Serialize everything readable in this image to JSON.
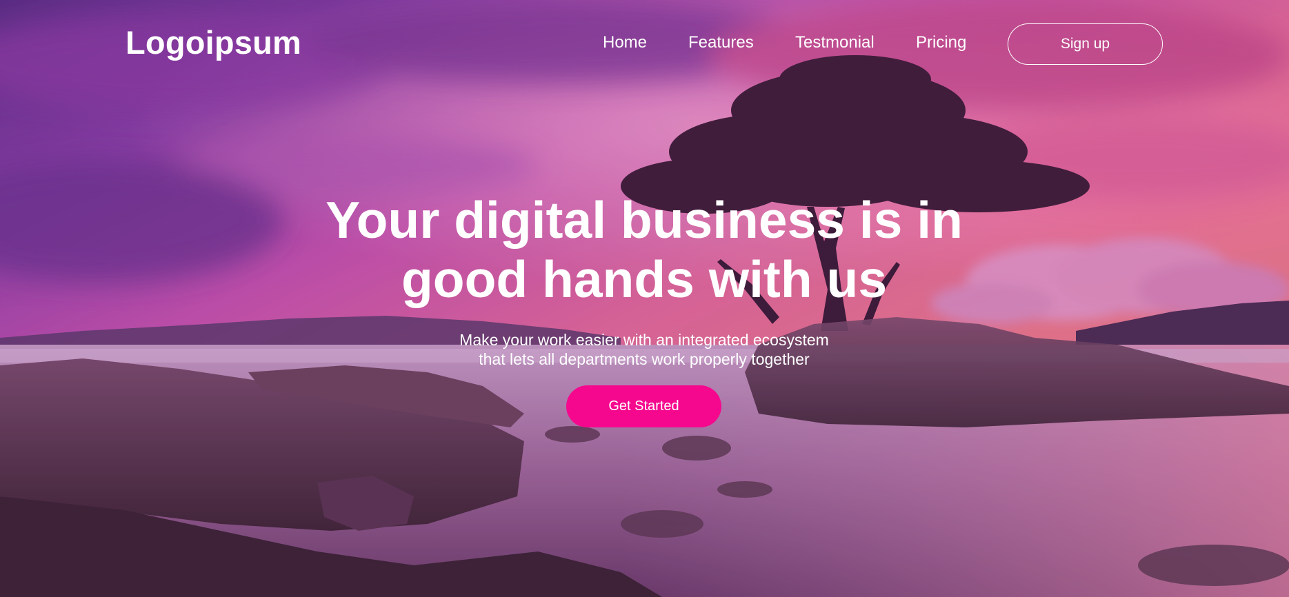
{
  "brand": {
    "logo_text": "Logoipsum"
  },
  "nav": {
    "items": [
      {
        "label": "Home"
      },
      {
        "label": "Features"
      },
      {
        "label": "Testmonial"
      },
      {
        "label": "Pricing"
      }
    ],
    "signup_label": "Sign up"
  },
  "hero": {
    "headline": "Your digital business is in good hands with us",
    "subtext_line1": "Make your work easier with an integrated ecosystem",
    "subtext_line2": "that lets all departments work properly together",
    "cta_label": "Get Started"
  },
  "colors": {
    "cta_background": "#f5088e",
    "text": "#ffffff"
  }
}
